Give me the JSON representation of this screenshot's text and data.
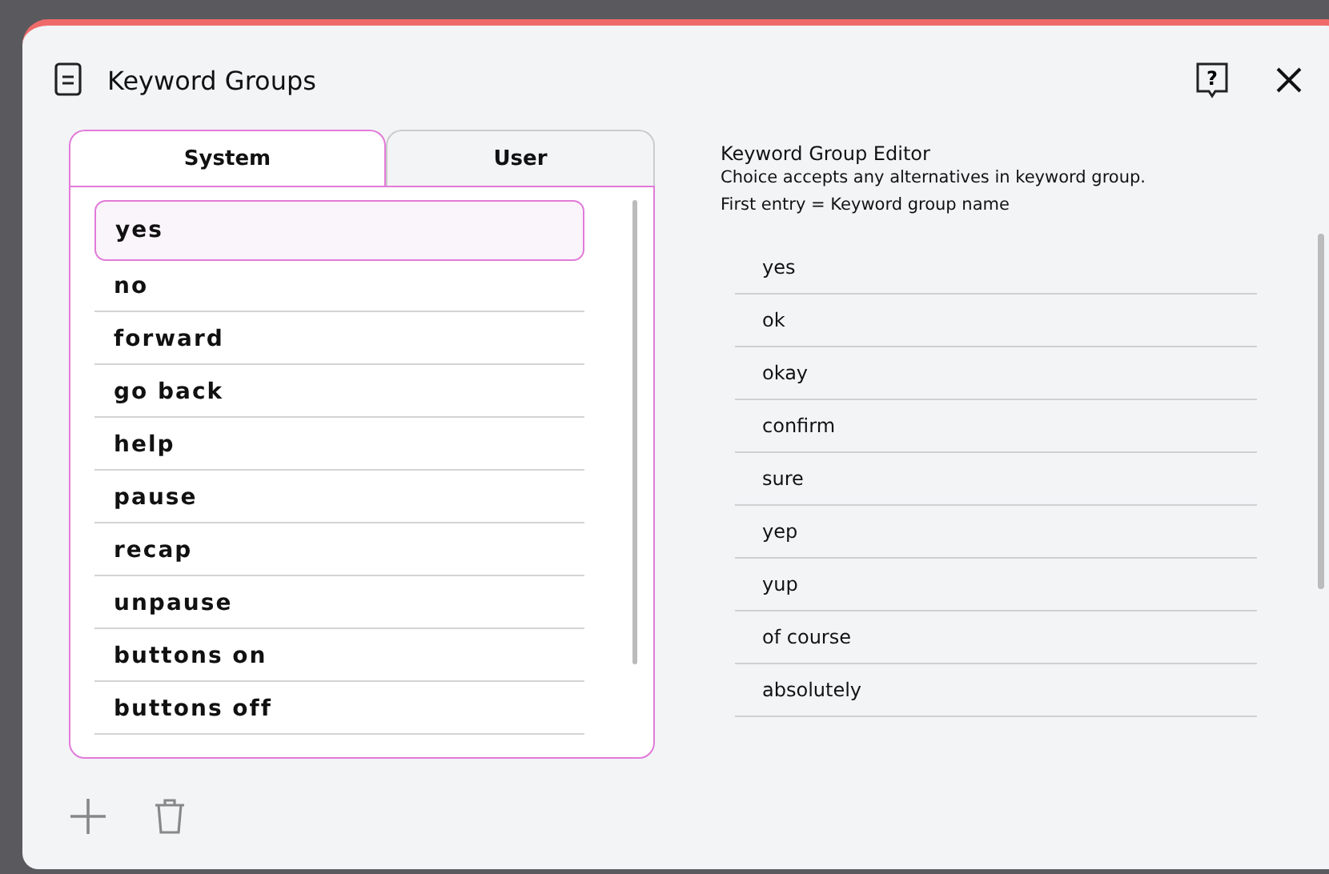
{
  "window": {
    "title": "Keyword Groups",
    "help_glyph": "?"
  },
  "tabs": [
    {
      "label": "System",
      "selected": true
    },
    {
      "label": "User",
      "selected": false
    }
  ],
  "groups": [
    {
      "label": "yes",
      "selected": true
    },
    {
      "label": "no",
      "selected": false
    },
    {
      "label": "forward",
      "selected": false
    },
    {
      "label": "go back",
      "selected": false
    },
    {
      "label": "help",
      "selected": false
    },
    {
      "label": "pause",
      "selected": false
    },
    {
      "label": "recap",
      "selected": false
    },
    {
      "label": "unpause",
      "selected": false
    },
    {
      "label": "buttons on",
      "selected": false
    },
    {
      "label": "buttons off",
      "selected": false
    }
  ],
  "editor": {
    "title": "Keyword Group Editor",
    "description": [
      "Choice accepts any alternatives in keyword group.",
      "First entry = Keyword group name"
    ],
    "entries": [
      "yes",
      "ok",
      "okay",
      "confirm",
      "sure",
      "yep",
      "yup",
      "of course",
      "absolutely"
    ]
  }
}
